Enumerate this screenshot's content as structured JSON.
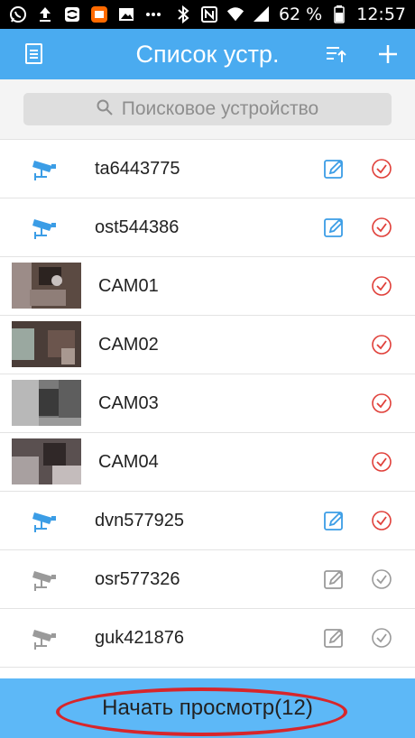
{
  "status_bar": {
    "battery_percent": "62 %",
    "time": "12:57",
    "icons": [
      "whatsapp-icon",
      "upload-icon",
      "sync-icon",
      "mi-app-icon",
      "image-icon",
      "more-dots-icon",
      "bluetooth-icon",
      "nfc-icon",
      "wifi-icon",
      "signal-icon",
      "battery-icon"
    ]
  },
  "app_bar": {
    "title": "Список устр.",
    "left_icon": "document-icon",
    "right_icons": [
      "sort-icon",
      "add-icon"
    ]
  },
  "search": {
    "placeholder": "Поисковое устройство",
    "icon": "search-icon"
  },
  "devices": [
    {
      "name": "ta6443775",
      "kind": "camera",
      "online": true,
      "editable": true
    },
    {
      "name": "ost544386",
      "kind": "camera",
      "online": true,
      "editable": true
    },
    {
      "name": "CAM01",
      "kind": "thumbnail",
      "online": true,
      "editable": false
    },
    {
      "name": "CAM02",
      "kind": "thumbnail",
      "online": true,
      "editable": false
    },
    {
      "name": "CAM03",
      "kind": "thumbnail",
      "online": true,
      "editable": false
    },
    {
      "name": "CAM04",
      "kind": "thumbnail",
      "online": true,
      "editable": false
    },
    {
      "name": "dvn577925",
      "kind": "camera",
      "online": true,
      "editable": true
    },
    {
      "name": "osr577326",
      "kind": "camera",
      "online": false,
      "editable": true
    },
    {
      "name": "guk421876",
      "kind": "camera",
      "online": false,
      "editable": true
    }
  ],
  "footer": {
    "start_label": "Начать просмотр(12)"
  },
  "colors": {
    "accent": "#4aabf0",
    "active_icon": "#3b9de6",
    "inactive_icon": "#9a9a9a",
    "check_red": "#e0403a",
    "annotation": "#d7262b"
  }
}
